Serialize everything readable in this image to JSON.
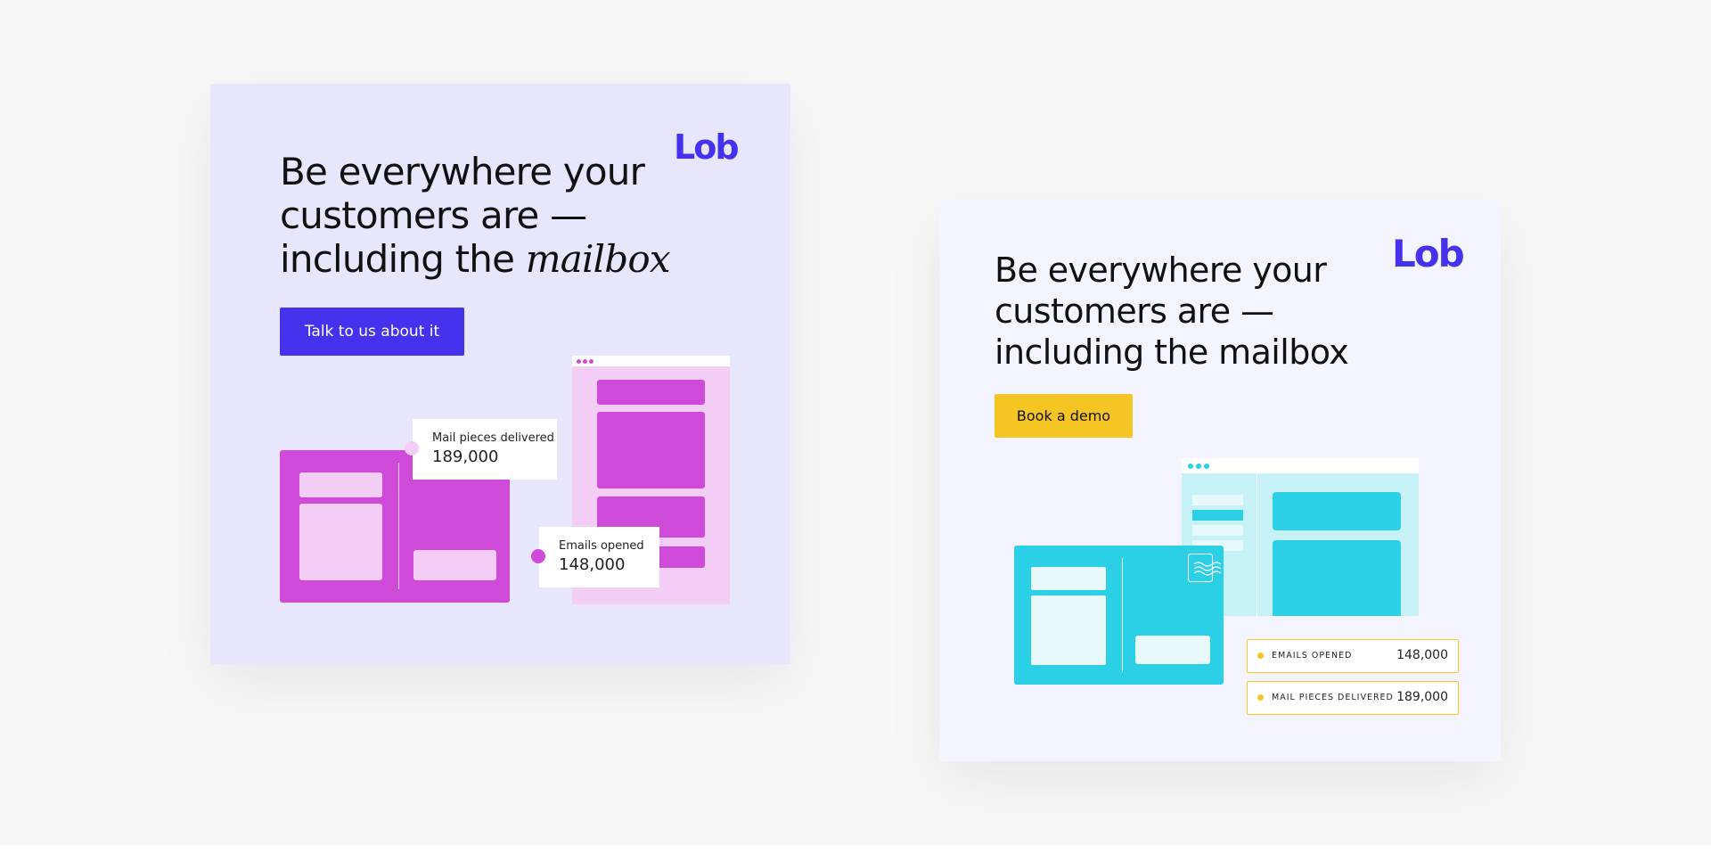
{
  "brand": {
    "name": "Lob",
    "accent": "#4432ee"
  },
  "card_a": {
    "logo": "Lob",
    "headline": {
      "line1": "Be everywhere your",
      "line2": "customers are —",
      "line3_prefix": "including the ",
      "line3_emphasis": "mailbox"
    },
    "cta_label": "Talk to us about it",
    "stats": [
      {
        "label": "Mail pieces delivered",
        "value": "189,000"
      },
      {
        "label": "Emails opened",
        "value": "148,000"
      }
    ],
    "colors": {
      "background": "#e8e6fc",
      "button": "#4432ee",
      "illustration": "#d04ad9",
      "illustration_light": "#f3cdf5"
    }
  },
  "card_b": {
    "logo": "Lob",
    "headline": {
      "line1": "Be everywhere your",
      "line2": "customers are —",
      "line3": "including the mailbox"
    },
    "cta_label": "Book a demo",
    "stats": [
      {
        "label": "EMAILS OPENED",
        "value": "148,000"
      },
      {
        "label": "MAIL PIECES DELIVERED",
        "value": "189,000"
      }
    ],
    "colors": {
      "background": "#f4f4fe",
      "button": "#f5c524",
      "illustration": "#2bcfe6",
      "illustration_light": "#c6f1f6"
    }
  }
}
